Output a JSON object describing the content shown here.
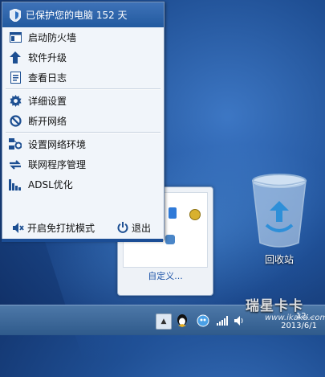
{
  "header": {
    "title": "已保护您的电脑 152 天",
    "icon": "shield-icon"
  },
  "menu": {
    "items": [
      {
        "label": "启动防火墙",
        "icon": "window-icon"
      },
      {
        "label": "软件升级",
        "icon": "arrow-up-icon"
      },
      {
        "label": "查看日志",
        "icon": "log-icon"
      },
      {
        "label": "详细设置",
        "icon": "gear-icon"
      },
      {
        "label": "断开网络",
        "icon": "block-icon"
      },
      {
        "label": "设置网络环境",
        "icon": "network-settings-icon"
      },
      {
        "label": "联网程序管理",
        "icon": "sync-icon"
      },
      {
        "label": "ADSL优化",
        "icon": "bar-chart-icon"
      }
    ],
    "quiet_mode_label": "开启免打扰模式",
    "exit_label": "退出"
  },
  "tray_panel": {
    "customize_label": "自定义..."
  },
  "desktop": {
    "recycle_bin_label": "回收站"
  },
  "taskbar": {
    "watermark": "瑞星卡卡",
    "site": "www.ikaka.com",
    "time": "12:…",
    "date": "2013/6/1"
  },
  "colors": {
    "accent": "#225a9f",
    "menu_bg": "#f1f5fa",
    "link": "#1f55a8"
  }
}
